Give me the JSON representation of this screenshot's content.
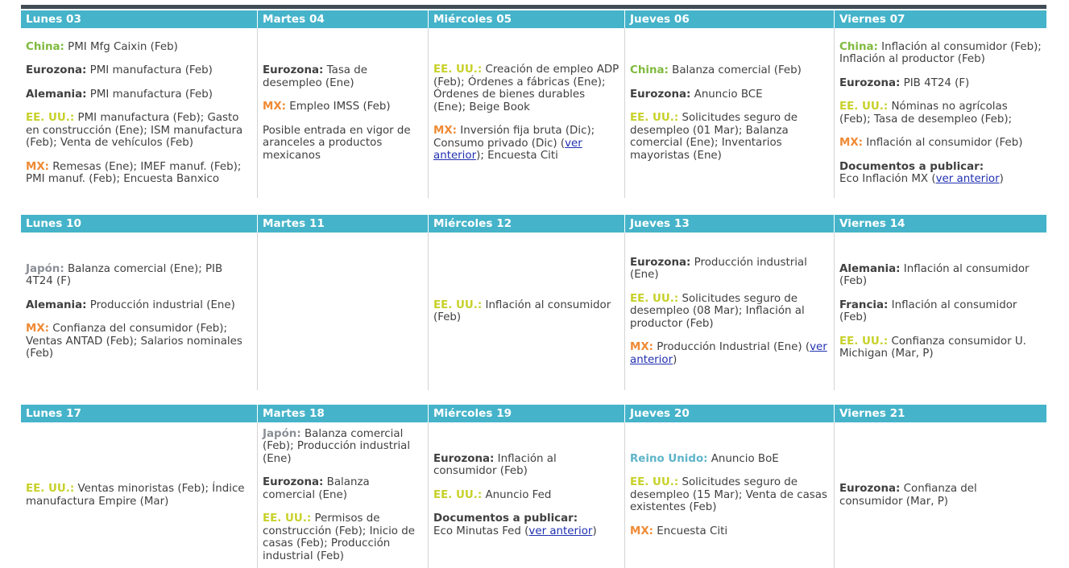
{
  "colors": {
    "header_bg": "#45b3c9",
    "header_text": "#ffffff",
    "top_rule": "#404b55",
    "china": "#7fba3e",
    "eurozona": "#404040",
    "alemania": "#404040",
    "francia": "#404040",
    "eeuu": "#c8d12a",
    "mx": "#ef8a34",
    "japon": "#8a8f96",
    "reino_unido": "#5fb4c9",
    "docs": "#404040",
    "link": "#1f2fb0"
  },
  "weeks": [
    {
      "days": [
        {
          "header": "Lunes 03",
          "entries": [
            {
              "label": "China:",
              "color": "china",
              "text": " PMI Mfg Caixin (Feb)"
            },
            {
              "label": "Eurozona:",
              "color": "eurozona",
              "text": " PMI manufactura (Feb)"
            },
            {
              "label": "Alemania:",
              "color": "alemania",
              "text": " PMI manufactura (Feb)"
            },
            {
              "label": "EE. UU.:",
              "color": "eeuu",
              "text": " PMI manufactura (Feb); Gasto en construcción (Ene); ISM manufactura (Feb); Venta de vehículos (Feb)"
            },
            {
              "label": "MX:",
              "color": "mx",
              "text": " Remesas (Ene); IMEF manuf. (Feb); PMI manuf. (Feb); Encuesta Banxico"
            }
          ]
        },
        {
          "header": "Martes 04",
          "entries": [
            {
              "label": "Eurozona:",
              "color": "eurozona",
              "text": " Tasa de desempleo (Ene)"
            },
            {
              "label": "MX:",
              "color": "mx",
              "text": " Empleo IMSS (Feb)"
            },
            {
              "label": "",
              "color": "",
              "text": "Posible entrada en vigor de aranceles a productos mexicanos"
            }
          ]
        },
        {
          "header": "Miércoles 05",
          "entries": [
            {
              "label": "EE. UU.:",
              "color": "eeuu",
              "text": " Creación de empleo ADP (Feb); Órdenes a fábricas (Ene); Órdenes de bienes durables (Ene); Beige Book"
            },
            {
              "label": "MX:",
              "color": "mx",
              "text": " Inversión fija bruta (Dic); Consumo privado (Dic) (",
              "link": "ver anterior",
              "after": "); Encuesta Citi"
            }
          ]
        },
        {
          "header": "Jueves 06",
          "entries": [
            {
              "label": "China:",
              "color": "china",
              "text": " Balanza comercial (Feb)"
            },
            {
              "label": "Eurozona:",
              "color": "eurozona",
              "text": " Anuncio BCE"
            },
            {
              "label": "EE. UU.:",
              "color": "eeuu",
              "text": " Solicitudes seguro de desempleo (01 Mar); Balanza comercial (Ene); Inventarios mayoristas (Ene)"
            }
          ]
        },
        {
          "header": "Viernes 07",
          "entries": [
            {
              "label": "China:",
              "color": "china",
              "text": " Inflación al consumidor (Feb); Inflación al productor (Feb)"
            },
            {
              "label": "Eurozona:",
              "color": "eurozona",
              "text": " PIB 4T24 (F)"
            },
            {
              "label": "EE. UU.:",
              "color": "eeuu",
              "text": " Nóminas no agrícolas (Feb); Tasa de desempleo (Feb);"
            },
            {
              "label": "MX:",
              "color": "mx",
              "text": " Inflación al consumidor (Feb)"
            },
            {
              "label": "Documentos a publicar:",
              "color": "docs",
              "block": true,
              "text": "Eco Inflación MX (",
              "link": "ver anterior",
              "after": ")"
            }
          ]
        }
      ]
    },
    {
      "days": [
        {
          "header": "Lunes 10",
          "entries": [
            {
              "label": "Japón:",
              "color": "japon",
              "text": " Balanza comercial (Ene); PIB 4T24 (F)"
            },
            {
              "label": "Alemania:",
              "color": "alemania",
              "text": " Producción industrial (Ene)"
            },
            {
              "label": "MX:",
              "color": "mx",
              "text": " Confianza del consumidor (Feb); Ventas ANTAD (Feb); Salarios nominales (Feb)"
            }
          ]
        },
        {
          "header": "Martes 11",
          "entries": []
        },
        {
          "header": "Miércoles 12",
          "entries": [
            {
              "label": "EE. UU.:",
              "color": "eeuu",
              "text": " Inflación al consumidor (Feb)"
            }
          ]
        },
        {
          "header": "Jueves 13",
          "entries": [
            {
              "label": "Eurozona:",
              "color": "eurozona",
              "text": " Producción industrial (Ene)"
            },
            {
              "label": "EE. UU.:",
              "color": "eeuu",
              "text": " Solicitudes seguro de desempleo (08 Mar); Inflación al productor (Feb)"
            },
            {
              "label": "MX:",
              "color": "mx",
              "text": " Producción Industrial (Ene) (",
              "link": "ver anterior",
              "after": ")"
            }
          ]
        },
        {
          "header": "Viernes 14",
          "entries": [
            {
              "label": "Alemania:",
              "color": "alemania",
              "text": " Inflación al consumidor (Feb)"
            },
            {
              "label": "Francia:",
              "color": "francia",
              "text": " Inflación al consumidor (Feb)"
            },
            {
              "label": "EE. UU.:",
              "color": "eeuu",
              "text": " Confianza consumidor U. Michigan (Mar, P)"
            }
          ]
        }
      ]
    },
    {
      "days": [
        {
          "header": "Lunes 17",
          "entries": [
            {
              "label": "EE. UU.:",
              "color": "eeuu",
              "text": " Ventas minoristas (Feb); Índice manufactura Empire (Mar)"
            }
          ]
        },
        {
          "header": "Martes 18",
          "entries": [
            {
              "label": "Japón:",
              "color": "japon",
              "text": " Balanza comercial (Feb); Producción industrial (Ene)"
            },
            {
              "label": "Eurozona:",
              "color": "eurozona",
              "text": " Balanza comercial (Ene)"
            },
            {
              "label": "EE. UU.:",
              "color": "eeuu",
              "text": " Permisos de construcción (Feb); Inicio de casas (Feb); Producción industrial (Feb)"
            }
          ]
        },
        {
          "header": "Miércoles 19",
          "entries": [
            {
              "label": "Eurozona:",
              "color": "eurozona",
              "text": " Inflación al consumidor (Feb)"
            },
            {
              "label": "EE. UU.:",
              "color": "eeuu",
              "text": " Anuncio Fed"
            },
            {
              "label": "Documentos a publicar:",
              "color": "docs",
              "block": true,
              "text": "Eco Minutas Fed (",
              "link": "ver anterior",
              "after": ")"
            }
          ]
        },
        {
          "header": "Jueves 20",
          "entries": [
            {
              "label": "Reino Unido:",
              "color": "reino_unido",
              "text": " Anuncio BoE"
            },
            {
              "label": "EE. UU.:",
              "color": "eeuu",
              "text": "  Solicitudes seguro de desempleo (15 Mar); Venta de casas existentes (Feb)"
            },
            {
              "label": "MX:",
              "color": "mx",
              "text": " Encuesta Citi"
            }
          ]
        },
        {
          "header": "Viernes 21",
          "entries": [
            {
              "label": "Eurozona:",
              "color": "eurozona",
              "text": " Confianza del consumidor (Mar, P)"
            }
          ]
        }
      ]
    }
  ]
}
